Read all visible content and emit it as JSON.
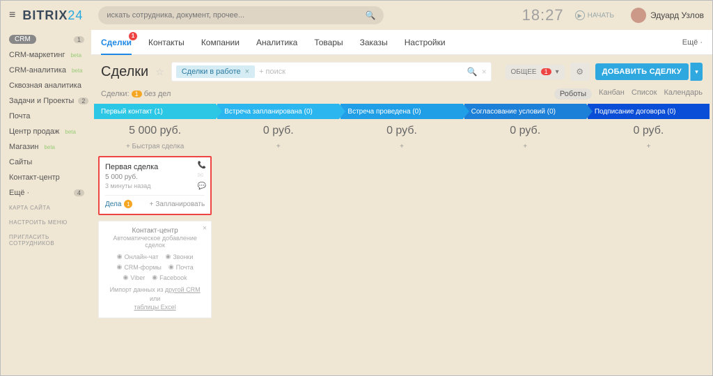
{
  "header": {
    "logo1": "BITRIX",
    "logo2": "24",
    "search_placeholder": "искать сотрудника, документ, прочее...",
    "clock": "18:27",
    "start": "НАЧАТЬ",
    "user_name": "Эдуард Узлов"
  },
  "sidebar": {
    "crm": "CRM",
    "crm_badge": "1",
    "items": [
      {
        "label": "CRM-маркетинг",
        "beta": true
      },
      {
        "label": "CRM-аналитика",
        "beta": true
      },
      {
        "label": "Сквозная аналитика"
      },
      {
        "label": "Задачи и Проекты",
        "badge": "2"
      },
      {
        "label": "Почта"
      },
      {
        "label": "Центр продаж",
        "beta": true
      },
      {
        "label": "Магазин",
        "beta": true
      },
      {
        "label": "Сайты"
      },
      {
        "label": "Контакт-центр"
      },
      {
        "label": "Ещё ·",
        "badge": "4"
      }
    ],
    "meta1": "КАРТА САЙТА",
    "meta2": "НАСТРОИТЬ МЕНЮ",
    "meta3": "ПРИГЛАСИТЬ СОТРУДНИКОВ"
  },
  "tabs": {
    "items": [
      "Сделки",
      "Контакты",
      "Компании",
      "Аналитика",
      "Товары",
      "Заказы",
      "Настройки"
    ],
    "active_badge": "1",
    "more": "Ещё ·"
  },
  "toolbar": {
    "title": "Сделки",
    "filter_chip": "Сделки в работе",
    "filter_placeholder": "+ поиск",
    "scope_label": "ОБЩЕЕ",
    "scope_count": "1",
    "add_label": "ДОБАВИТЬ СДЕЛКУ"
  },
  "subbar": {
    "text": "Сделки:",
    "count": "1",
    "nodeals": "без дел",
    "views": [
      "Роботы",
      "Канбан",
      "Список",
      "Календарь"
    ]
  },
  "stages": [
    {
      "name": "Первый контакт",
      "count": "(1)",
      "total": "5 000 руб.",
      "quick": "+ Быстрая сделка"
    },
    {
      "name": "Встреча запланирована",
      "count": "(0)",
      "total": "0 руб.",
      "quick": "+"
    },
    {
      "name": "Встреча проведена",
      "count": "(0)",
      "total": "0 руб.",
      "quick": "+"
    },
    {
      "name": "Согласование условий",
      "count": "(0)",
      "total": "0 руб.",
      "quick": "+"
    },
    {
      "name": "Подписание договора",
      "count": "(0)",
      "total": "0 руб.",
      "quick": "+"
    }
  ],
  "deal": {
    "title": "Первая сделка",
    "amount": "5 000 руб.",
    "time": "3 минуты назад",
    "activities_label": "Дела",
    "activities_count": "1",
    "plan": "+ Запланировать"
  },
  "promo": {
    "title": "Контакт-центр",
    "sub": "Автоматическое добавление сделок",
    "items": [
      "Онлайн-чат",
      "Звонки",
      "CRM-формы",
      "Почта",
      "Viber",
      "Facebook"
    ],
    "import_pre": "Импорт данных из ",
    "import_crm": "другой CRM",
    "import_or": " или ",
    "import_excel": "таблицы Excel"
  }
}
